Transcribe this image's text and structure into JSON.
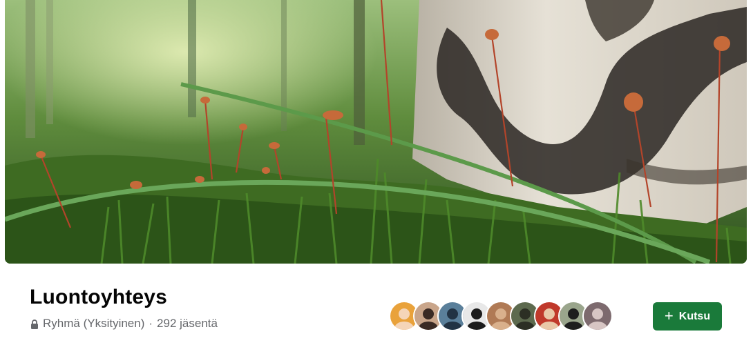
{
  "cover": {
    "image": "nature-cover-photo",
    "description_icon": "forest-moss-birch-photo"
  },
  "group": {
    "name": "Luontoyhteys",
    "privacy": "Ryhmä (Yksityinen)",
    "separator": "·",
    "members_count": "292 jäsentä"
  },
  "members": {
    "avatars": [
      {
        "name": "member-avatar-1",
        "bg": "#e9a23b",
        "fg": "#f5d5b8"
      },
      {
        "name": "member-avatar-2",
        "bg": "#c9a58a",
        "fg": "#3a2a24"
      },
      {
        "name": "member-avatar-3",
        "bg": "#5a7f9a",
        "fg": "#223344"
      },
      {
        "name": "member-avatar-4",
        "bg": "#e8e8e8",
        "fg": "#1c1c1c"
      },
      {
        "name": "member-avatar-5",
        "bg": "#b07a55",
        "fg": "#d9b08c"
      },
      {
        "name": "member-avatar-6",
        "bg": "#5d6a4e",
        "fg": "#2c2f24"
      },
      {
        "name": "member-avatar-7",
        "bg": "#c0392b",
        "fg": "#e9c8a8"
      },
      {
        "name": "member-avatar-8",
        "bg": "#9aa58c",
        "fg": "#1e1e1e"
      },
      {
        "name": "member-avatar-9",
        "bg": "#7d6a6e",
        "fg": "#d7c6c4"
      }
    ]
  },
  "actions": {
    "invite_label": "Kutsu",
    "invite_icon": "plus-icon"
  },
  "colors": {
    "primary": "#1a7a3a",
    "text": "#050505",
    "secondary_text": "#65676b"
  }
}
